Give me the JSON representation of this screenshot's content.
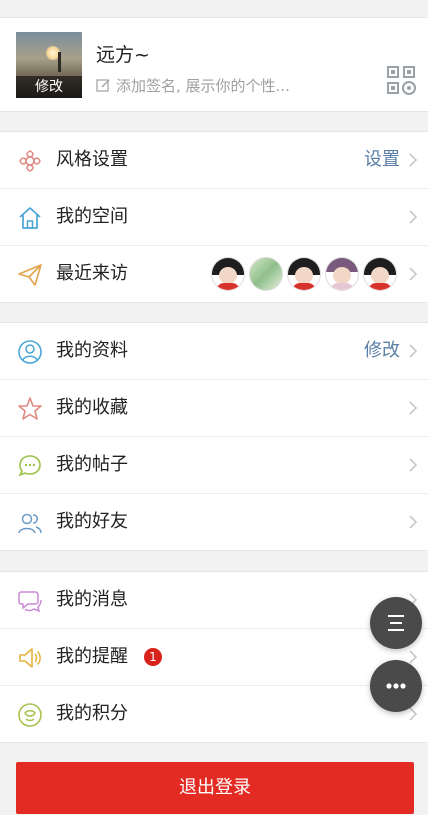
{
  "profile": {
    "avatar_edit_label": "修改",
    "username": "远方~",
    "signature_placeholder": "添加签名, 展示你的个性..."
  },
  "groups": [
    {
      "items": [
        {
          "label": "风格设置",
          "icon": "flower-icon",
          "right_text": "设置"
        },
        {
          "label": "我的空间",
          "icon": "home-icon"
        },
        {
          "label": "最近来访",
          "icon": "paper-plane-icon",
          "visitors_count": 5
        }
      ]
    },
    {
      "items": [
        {
          "label": "我的资料",
          "icon": "person-circle-icon",
          "right_text": "修改"
        },
        {
          "label": "我的收藏",
          "icon": "star-icon"
        },
        {
          "label": "我的帖子",
          "icon": "chat-bubble-icon"
        },
        {
          "label": "我的好友",
          "icon": "friends-icon"
        }
      ]
    },
    {
      "items": [
        {
          "label": "我的消息",
          "icon": "messages-icon"
        },
        {
          "label": "我的提醒",
          "icon": "speaker-icon",
          "badge": "1"
        },
        {
          "label": "我的积分",
          "icon": "coin-icon"
        }
      ]
    }
  ],
  "logout_label": "退出登录",
  "colors": {
    "accent_link": "#5a7ea6",
    "logout_red": "#e32a23",
    "badge_red": "#d8221a",
    "fab_gray": "#4a4a4a"
  }
}
